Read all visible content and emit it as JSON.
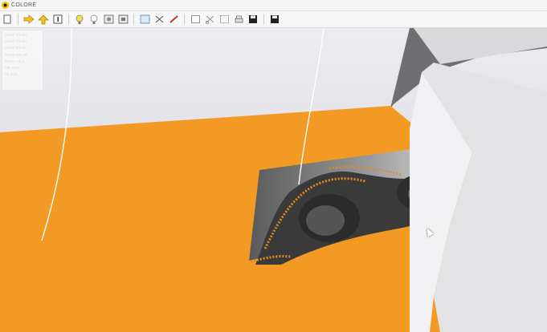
{
  "window": {
    "title": "COLORE"
  },
  "toolbar": {
    "icons": [
      "new-file-icon",
      "arrow-right-icon",
      "arrow-up-icon",
      "info-icon",
      "bulb-on-icon",
      "bulb-off-icon",
      "camera-icon",
      "camera-alt-icon",
      "window-icon",
      "scissors-icon",
      "pencil-icon",
      "frame-icon",
      "cut-icon",
      "select-icon",
      "printer-icon",
      "save-icon",
      "save-as-icon"
    ]
  },
  "readout": {
    "lines": [
      "ASSE X/0.00",
      "ASSE Y/0.00",
      "ASSE Z/0.00",
      "ASSE W/0.00",
      "ASSE A/0.0",
      "Vel. 0.00",
      "Vt. 0.00"
    ]
  },
  "colors": {
    "floor": "#f29a23",
    "wall": "#e9e9ee",
    "panel": "#e3e3e6",
    "relief": "#3a3a3a",
    "tool": "#f5d21c",
    "marker": "#1f4fd8"
  }
}
